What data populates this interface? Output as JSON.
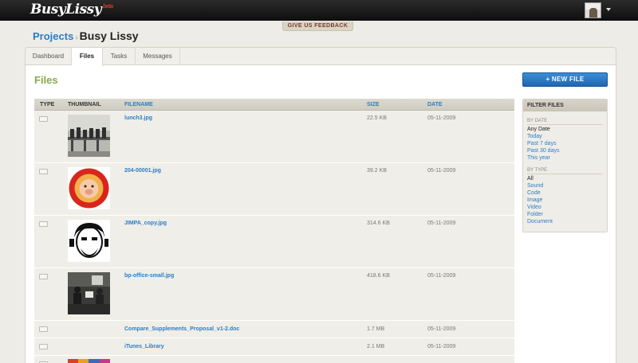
{
  "app": {
    "logo": "BusyLissy",
    "beta": "beta",
    "feedback": "GIVE US FEEDBACK"
  },
  "breadcrumb": {
    "parent": "Projects",
    "separator": "›",
    "current": "Busy Lissy"
  },
  "tabs": [
    {
      "label": "Dashboard"
    },
    {
      "label": "Files"
    },
    {
      "label": "Tasks"
    },
    {
      "label": "Messages"
    }
  ],
  "files": {
    "title": "Files",
    "new_file": "+ NEW FILE",
    "columns": {
      "type": "TYPE",
      "thumbnail": "THUMBNAIL",
      "filename": "FILENAME",
      "size": "SIZE",
      "date": "DATE"
    },
    "rows": [
      {
        "filename": "lunch3.jpg",
        "size": "22.5 KB",
        "date": "05-11-2009"
      },
      {
        "filename": "204-00001.jpg",
        "size": "39.2 KB",
        "date": "05-11-2009"
      },
      {
        "filename": "JIMPA_copy.jpg",
        "size": "314.6 KB",
        "date": "05-11-2009"
      },
      {
        "filename": "bp-office-small.jpg",
        "size": "418.6 KB",
        "date": "05-11-2009"
      },
      {
        "filename": "Compare_Supplements_Proposal_v1-2.doc",
        "size": "1.7 MB",
        "date": "05-11-2009"
      },
      {
        "filename": "iTunes_Library",
        "size": "2.1 MB",
        "date": "05-11-2009"
      }
    ]
  },
  "filter": {
    "title": "FILTER FILES",
    "by_date_label": "BY DATE",
    "by_date": [
      "Any Date",
      "Today",
      "Past 7 days",
      "Past 30 days",
      "This year"
    ],
    "by_type_label": "BY TYPE",
    "by_type": [
      "All",
      "Sound",
      "Code",
      "Image",
      "Video",
      "Folder",
      "Document"
    ]
  },
  "colors": {
    "accent_blue": "#2a7dc8",
    "files_green": "#8aa84a",
    "button_blue": "#1f66b0"
  }
}
